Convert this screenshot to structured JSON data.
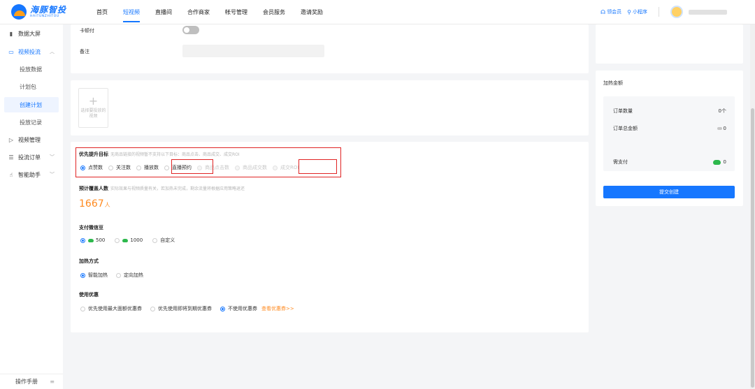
{
  "brand": {
    "name_cn": "海豚智投",
    "name_en": "HAITUNZHITOU"
  },
  "nav": {
    "items": [
      "首页",
      "短视频",
      "直播间",
      "合作商家",
      "帐号管理",
      "会员服务",
      "邀请奖励"
    ],
    "active_index": 1
  },
  "header_right": {
    "member_link": "领会员",
    "miniapp_link": "小程序"
  },
  "sidebar": {
    "dashboard": "数据大屏",
    "video_ads": "视频投流",
    "sub_items": [
      "投放数据",
      "计划包",
      "创建计划",
      "投放记录"
    ],
    "active_sub": "创建计划",
    "video_manage": "视频管理",
    "ad_orders": "投流订单",
    "smart_assistant": "智能助手",
    "manual": "操作手册"
  },
  "form_top": {
    "card_pay_label": "卡顿付",
    "note_label": "备注"
  },
  "upload": {
    "text": "选择要投放的视频"
  },
  "goal": {
    "title": "优先提升目标",
    "hint": "无商品链接的视频暂不支持以下目标：商品点击、商品成交、成交ROI",
    "options": [
      "点赞数",
      "关注数",
      "播放数",
      "直播预约",
      "商品点击数",
      "商品成交数",
      "成交ROI"
    ],
    "selected": "点赞数"
  },
  "estimate": {
    "title": "预计覆盖人数",
    "hint": "实际效果与视频质量有关，若加热未完成，剩余流量将根据应用策略退还",
    "value": "1667",
    "unit": "人"
  },
  "pay_beans": {
    "title": "支付微信豆",
    "options": [
      "500",
      "1000",
      "自定义"
    ],
    "selected": "500"
  },
  "heat_mode": {
    "title": "加热方式",
    "options": [
      "智能加热",
      "定向加热"
    ],
    "selected": "智能加热"
  },
  "coupon": {
    "title": "使用优惠",
    "options": [
      "优先使用最大面额优惠券",
      "优先使用即将到期优惠券",
      "不使用优惠券"
    ],
    "selected": "不使用优惠券",
    "view_link": "查看优惠券>>"
  },
  "summary": {
    "title": "加热金额",
    "order_count_label": "订单数量",
    "order_count_value": "0个",
    "order_total_label": "订单总金额",
    "order_total_value": "0",
    "need_pay_label": "需支付",
    "need_pay_value": "0",
    "submit": "提交创建"
  },
  "colors": {
    "accent": "#1677ff",
    "highlight": "#ff8a1f",
    "bean": "#2db84c",
    "annotation": "#e02424"
  }
}
